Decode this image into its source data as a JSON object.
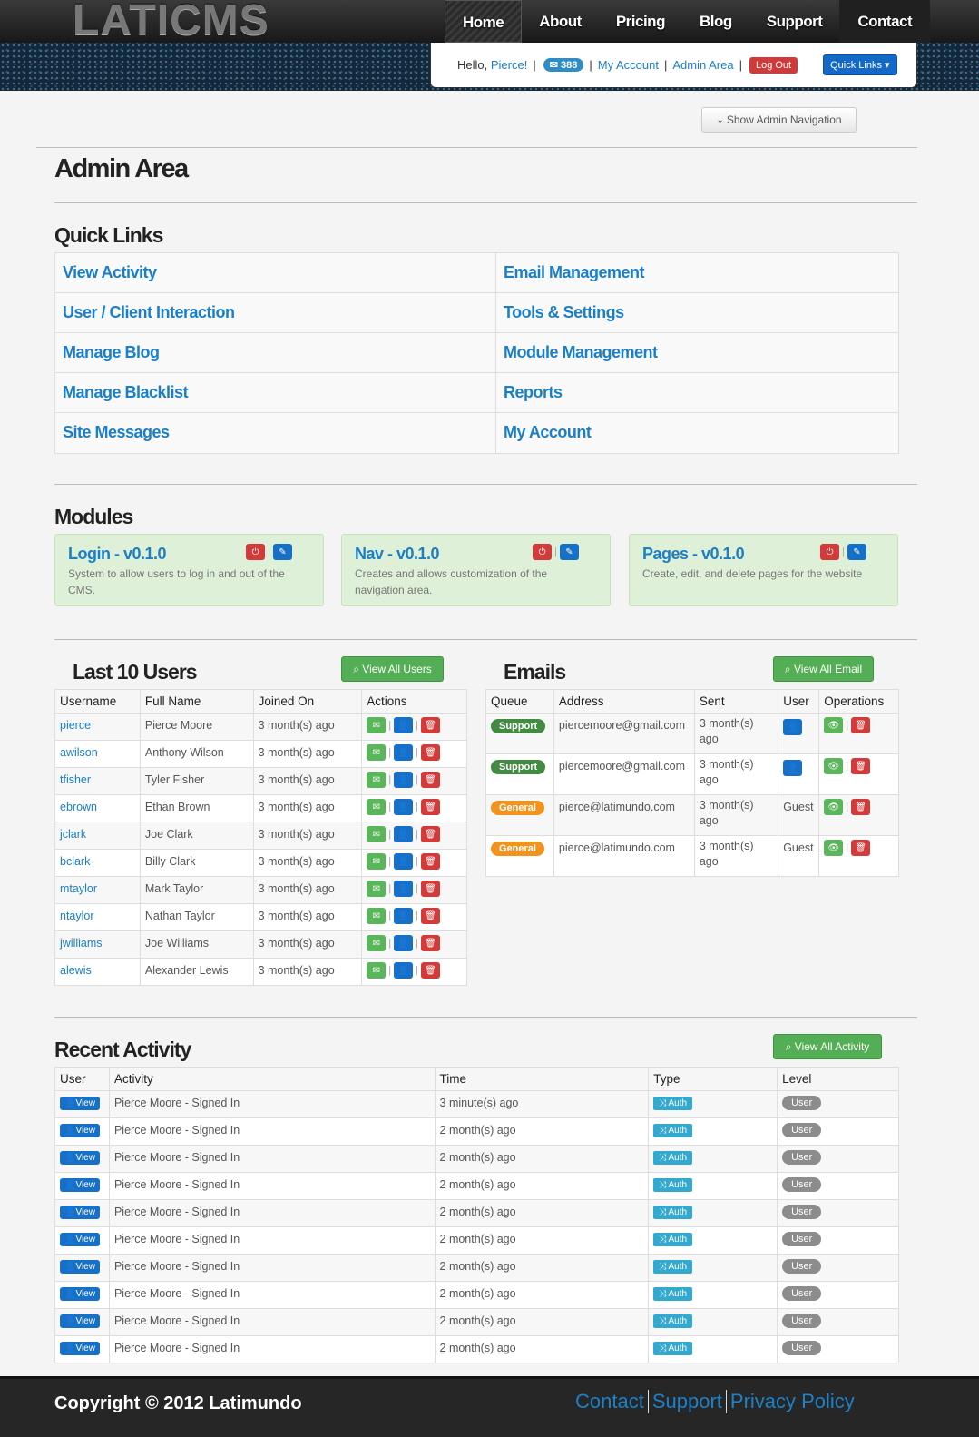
{
  "header": {
    "logo": "LATICMS",
    "nav": [
      "Home",
      "About",
      "Pricing",
      "Blog",
      "Support",
      "Contact"
    ],
    "greeting": "Hello,",
    "username": "Pierce!",
    "message_count": "388",
    "my_account": "My Account",
    "admin_area": "Admin Area",
    "logout": "Log Out",
    "quick_links": "Quick Links"
  },
  "admin_nav_toggle": "Show Admin Navigation",
  "page_title": "Admin Area",
  "quick_links": {
    "title": "Quick Links",
    "rows": [
      [
        "View Activity",
        "Email Management"
      ],
      [
        "User / Client Interaction",
        "Tools & Settings"
      ],
      [
        "Manage Blog",
        "Module Management"
      ],
      [
        "Manage Blacklist",
        "Reports"
      ],
      [
        "Site Messages",
        "My Account"
      ]
    ]
  },
  "modules": {
    "title": "Modules",
    "items": [
      {
        "name": "Login - v0.1.0",
        "desc": "System to allow users to log in and out of the CMS."
      },
      {
        "name": "Nav - v0.1.0",
        "desc": "Creates and allows customization of the navigation area."
      },
      {
        "name": "Pages - v0.1.0",
        "desc": "Create, edit, and delete pages for the website"
      }
    ]
  },
  "users": {
    "title": "Last 10 Users",
    "view_all": "View All Users",
    "columns": [
      "Username",
      "Full Name",
      "Joined On",
      "Actions"
    ],
    "rows": [
      [
        "pierce",
        "Pierce Moore",
        "3 month(s) ago"
      ],
      [
        "awilson",
        "Anthony Wilson",
        "3 month(s) ago"
      ],
      [
        "tfisher",
        "Tyler Fisher",
        "3 month(s) ago"
      ],
      [
        "ebrown",
        "Ethan Brown",
        "3 month(s) ago"
      ],
      [
        "jclark",
        "Joe Clark",
        "3 month(s) ago"
      ],
      [
        "bclark",
        "Billy Clark",
        "3 month(s) ago"
      ],
      [
        "mtaylor",
        "Mark Taylor",
        "3 month(s) ago"
      ],
      [
        "ntaylor",
        "Nathan Taylor",
        "3 month(s) ago"
      ],
      [
        "jwilliams",
        "Joe Williams",
        "3 month(s) ago"
      ],
      [
        "alewis",
        "Alexander Lewis",
        "3 month(s) ago"
      ]
    ]
  },
  "emails": {
    "title": "Emails",
    "view_all": "View All Email",
    "columns": [
      "Queue",
      "Address",
      "Sent",
      "User",
      "Operations"
    ],
    "rows": [
      {
        "queue": "Support",
        "address": "piercemoore@gmail.com",
        "sent": "3 month(s) ago",
        "user": ""
      },
      {
        "queue": "Support",
        "address": "piercemoore@gmail.com",
        "sent": "3 month(s) ago",
        "user": ""
      },
      {
        "queue": "General",
        "address": "pierce@latimundo.com",
        "sent": "3 month(s) ago",
        "user": "Guest"
      },
      {
        "queue": "General",
        "address": "pierce@latimundo.com",
        "sent": "3 month(s) ago",
        "user": "Guest"
      }
    ]
  },
  "activity": {
    "title": "Recent Activity",
    "view_all": "View All Activity",
    "columns": [
      "User",
      "Activity",
      "Time",
      "Type",
      "Level"
    ],
    "view_label": "View",
    "type_label": "Auth",
    "level_label": "User",
    "rows": [
      [
        "Pierce Moore - Signed In",
        "3 minute(s) ago"
      ],
      [
        "Pierce Moore - Signed In",
        "2 month(s) ago"
      ],
      [
        "Pierce Moore - Signed In",
        "2 month(s) ago"
      ],
      [
        "Pierce Moore - Signed In",
        "2 month(s) ago"
      ],
      [
        "Pierce Moore - Signed In",
        "2 month(s) ago"
      ],
      [
        "Pierce Moore - Signed In",
        "2 month(s) ago"
      ],
      [
        "Pierce Moore - Signed In",
        "2 month(s) ago"
      ],
      [
        "Pierce Moore - Signed In",
        "2 month(s) ago"
      ],
      [
        "Pierce Moore - Signed In",
        "2 month(s) ago"
      ],
      [
        "Pierce Moore - Signed In",
        "2 month(s) ago"
      ]
    ]
  },
  "footer": {
    "copyright": "Copyright © 2012 Latimundo",
    "links": [
      "Contact",
      "Support",
      "Privacy Policy"
    ]
  },
  "colors": {
    "link": "#1a7fc8",
    "success": "#54ae55",
    "danger": "#d33a3a",
    "primary": "#1670c7",
    "info": "#34a9cf",
    "warning": "#f1931c"
  }
}
